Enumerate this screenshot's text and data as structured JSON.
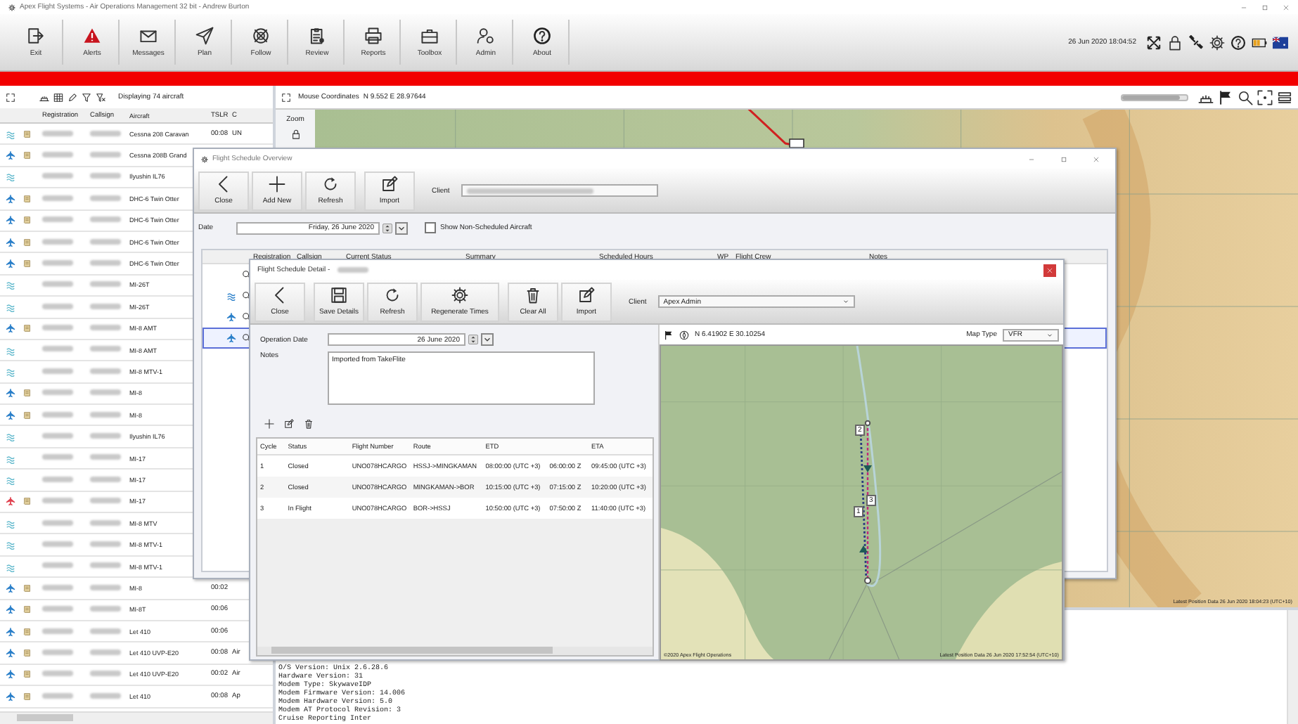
{
  "window": {
    "title": "Apex Flight Systems - Air Operations Management 32 bit - Andrew Burton"
  },
  "toolbar": {
    "buttons": [
      {
        "label": "Exit"
      },
      {
        "label": "Alerts"
      },
      {
        "label": "Messages"
      },
      {
        "label": "Plan"
      },
      {
        "label": "Follow"
      },
      {
        "label": "Review"
      },
      {
        "label": "Reports"
      },
      {
        "label": "Toolbox"
      },
      {
        "label": "Admin"
      },
      {
        "label": "About"
      }
    ],
    "clock": "26 Jun 2020 18:04:52"
  },
  "aircraft_panel": {
    "summary": "Displaying 74 aircraft",
    "columns": [
      "Registration",
      "Callsign",
      "Aircraft",
      "TSLR",
      "C"
    ],
    "rows": [
      {
        "kind": "landed",
        "color": "#5fb8cc",
        "log": true,
        "aircraft": "Cessna 208 Caravan",
        "tslr": "00:08",
        "column_5": "UN"
      },
      {
        "kind": "airborne",
        "color": "#2a7fc9",
        "log": true,
        "aircraft": "Cessna 208B Grand"
      },
      {
        "kind": "landed",
        "color": "#5fb8cc",
        "log": false,
        "aircraft": "Ilyushin IL76"
      },
      {
        "kind": "airborne",
        "color": "#2a7fc9",
        "log": true,
        "aircraft": "DHC-6 Twin Otter"
      },
      {
        "kind": "airborne",
        "color": "#2a7fc9",
        "log": true,
        "aircraft": "DHC-6 Twin Otter"
      },
      {
        "kind": "airborne",
        "color": "#2a7fc9",
        "log": true,
        "aircraft": "DHC-6 Twin Otter"
      },
      {
        "kind": "airborne",
        "color": "#2a7fc9",
        "log": true,
        "aircraft": "DHC-6 Twin Otter"
      },
      {
        "kind": "landed",
        "color": "#5fb8cc",
        "log": false,
        "aircraft": "MI-26T"
      },
      {
        "kind": "landed",
        "color": "#5fb8cc",
        "log": false,
        "aircraft": "MI-26T"
      },
      {
        "kind": "airborne",
        "color": "#2a7fc9",
        "log": true,
        "aircraft": "MI-8 AMT"
      },
      {
        "kind": "landed",
        "color": "#5fb8cc",
        "log": false,
        "aircraft": "MI-8 AMT"
      },
      {
        "kind": "landed",
        "color": "#5fb8cc",
        "log": false,
        "aircraft": "MI-8 MTV-1"
      },
      {
        "kind": "airborne",
        "color": "#2a7fc9",
        "log": true,
        "aircraft": "MI-8"
      },
      {
        "kind": "airborne",
        "color": "#2a7fc9",
        "log": true,
        "aircraft": "MI-8"
      },
      {
        "kind": "landed",
        "color": "#5fb8cc",
        "log": false,
        "aircraft": "Ilyushin IL76"
      },
      {
        "kind": "landed",
        "color": "#5fb8cc",
        "log": false,
        "aircraft": "MI-17"
      },
      {
        "kind": "landed",
        "color": "#5fb8cc",
        "log": false,
        "aircraft": "MI-17"
      },
      {
        "kind": "airborne",
        "color": "#e0404e",
        "log": true,
        "aircraft": "MI-17"
      },
      {
        "kind": "landed",
        "color": "#5fb8cc",
        "log": false,
        "aircraft": "MI-8 MTV"
      },
      {
        "kind": "landed",
        "color": "#5fb8cc",
        "log": false,
        "aircraft": "MI-8 MTV-1"
      },
      {
        "kind": "landed",
        "color": "#5fb8cc",
        "log": false,
        "aircraft": "MI-8 MTV-1"
      },
      {
        "kind": "airborne",
        "color": "#2a7fc9",
        "log": true,
        "aircraft": "MI-8",
        "tslr": "00:02"
      },
      {
        "kind": "airborne",
        "color": "#2a7fc9",
        "log": true,
        "aircraft": "MI-8T",
        "tslr": "00:06"
      },
      {
        "kind": "airborne",
        "color": "#2a7fc9",
        "log": true,
        "aircraft": "Let 410",
        "tslr": "00:06"
      },
      {
        "kind": "airborne",
        "color": "#2a7fc9",
        "log": true,
        "aircraft": "Let 410 UVP-E20",
        "tslr": "00:08",
        "column_5": "Air"
      },
      {
        "kind": "airborne",
        "color": "#2a7fc9",
        "log": true,
        "aircraft": "Let 410 UVP-E20",
        "tslr": "00:02",
        "column_5": "Air"
      },
      {
        "kind": "airborne",
        "color": "#2a7fc9",
        "log": true,
        "aircraft": "Let 410",
        "tslr": "00:08",
        "column_5": "Ap"
      }
    ]
  },
  "map": {
    "zoom": {
      "level": 0.9
    },
    "coordinates_label": "Mouse Coordinates",
    "coordinates": "N 9.552 E 28.97644",
    "zoom_label": "Zoom",
    "position_note": "Latest Position Data 26 Jun 2020 18:04:23 (UTC+10)"
  },
  "log_pane": {
    "lines": [
      "O/S Version: Unix 2.6.28.6",
      "Hardware Version: 31",
      "Modem Type: SkywaveIDP",
      "Modem Firmware Version: 14.006",
      "Modem Hardware Version: 5.0",
      "Modem AT Protocol Revision: 3",
      "Cruise Reporting Inter"
    ]
  },
  "overview": {
    "title": "Flight Schedule Overview",
    "buttons": [
      {
        "label": "Close"
      },
      {
        "label": "Add New"
      },
      {
        "label": "Refresh"
      },
      {
        "label": "Import"
      }
    ],
    "client_label": "Client",
    "date_label": "Date",
    "date": "Friday, 26 June 2020",
    "show_non_scheduled": {
      "label": "Show Non-Scheduled Aircraft",
      "checked": false
    },
    "columns": [
      "Registration",
      "Callsign",
      "Current Status",
      "Summary",
      "Scheduled Hours",
      "WP",
      "Flight Crew",
      "Notes"
    ],
    "rows": [
      {
        "kind": "none",
        "selected": false
      },
      {
        "kind": "landed",
        "selected": false
      },
      {
        "kind": "airborne",
        "selected": false
      },
      {
        "kind": "airborne",
        "selected": true
      }
    ]
  },
  "detail": {
    "title": "Flight Schedule Detail -",
    "buttons": [
      {
        "label": "Close"
      },
      {
        "label": "Save Details"
      },
      {
        "label": "Refresh"
      },
      {
        "label": "Regenerate Times"
      },
      {
        "label": "Clear All"
      },
      {
        "label": "Import"
      }
    ],
    "client_label": "Client",
    "client": "Apex Admin",
    "operation_date_label": "Operation Date",
    "operation_date": "26 June 2020",
    "notes_label": "Notes",
    "notes": "Imported from TakeFlite",
    "columns": [
      "Cycle",
      "Status",
      "Flight Number",
      "Route",
      "ETD",
      "ETA"
    ],
    "legs": [
      {
        "cycle": "1",
        "status": "Closed",
        "flight_number": "UNO078HCARGO",
        "route": "HSSJ->MINGKAMAN",
        "etd": "08:00:00 (UTC +3)",
        "etd_utc": "06:00:00 Z",
        "eta": "09:45:00 (UTC +3)"
      },
      {
        "cycle": "2",
        "status": "Closed",
        "flight_number": "UNO078HCARGO",
        "route": "MINGKAMAN->BOR",
        "etd": "10:15:00 (UTC +3)",
        "etd_utc": "07:15:00 Z",
        "eta": "10:20:00 (UTC +3)"
      },
      {
        "cycle": "3",
        "status": "In Flight",
        "flight_number": "UNO078HCARGO",
        "route": "BOR->HSSJ",
        "etd": "10:50:00 (UTC +3)",
        "etd_utc": "07:50:00 Z",
        "eta": "11:40:00 (UTC +3)"
      }
    ],
    "map": {
      "coordinates": "N 6.41902 E 30.10254",
      "map_type_label": "Map Type",
      "map_type": "VFR",
      "waypoints": [
        {
          "label": "2"
        },
        {
          "label": "3"
        },
        {
          "label": "1"
        }
      ],
      "copyright": "©2020 Apex Flight Operations",
      "position_note": "Latest Position Data 26 Jun 2020 17:52:54 (UTC+10)"
    }
  }
}
